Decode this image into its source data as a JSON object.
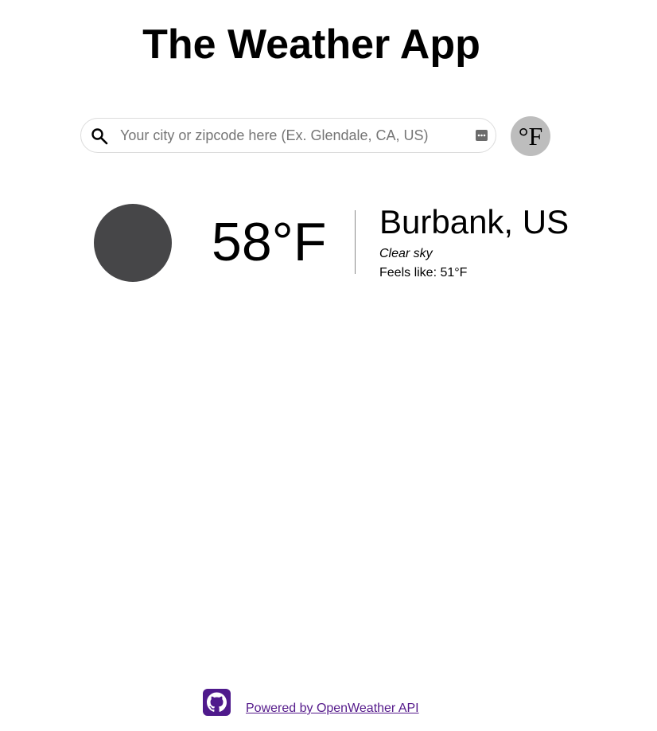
{
  "header": {
    "title": "The Weather App"
  },
  "search": {
    "placeholder": "Your city or zipcode here (Ex. Glendale, CA, US)",
    "value": ""
  },
  "unit_toggle": {
    "label": "°F"
  },
  "current_weather": {
    "icon": "weather-condition-icon",
    "temperature": "58°F",
    "location": "Burbank, US",
    "condition": "Clear sky",
    "feels_like": "Feels like: 51°F"
  },
  "footer": {
    "github_icon": "github-icon",
    "powered_by": "Powered by OpenWeather API"
  },
  "colors": {
    "weather_icon": "#464648",
    "unit_toggle_bg": "#bdbdbd",
    "github_bg": "#4f1a8c",
    "link": "#551a8b"
  }
}
